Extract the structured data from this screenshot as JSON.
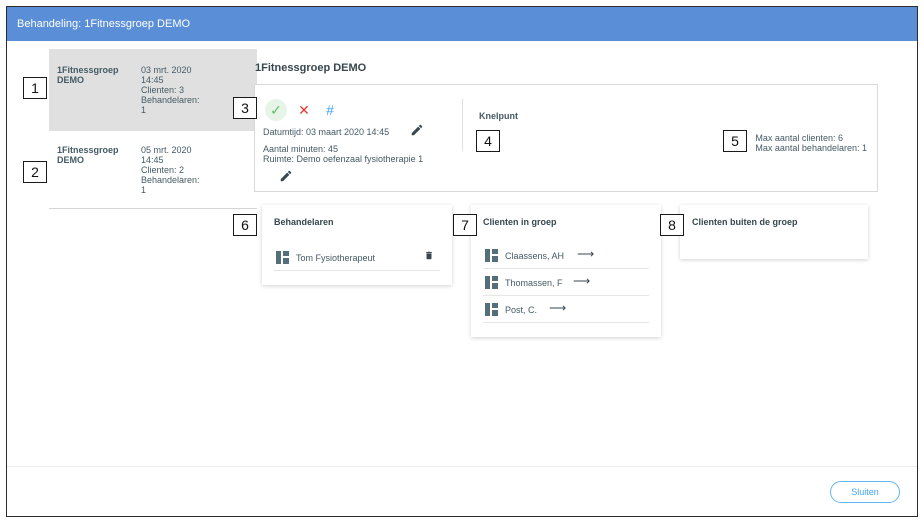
{
  "window": {
    "title": "Behandeling: 1Fitnessgroep DEMO"
  },
  "sessions": [
    {
      "name": "1Fitnessgroep DEMO",
      "date": "03 mrt. 2020",
      "time": "14:45",
      "clients": "Clienten: 3",
      "therapists": "Behandelaren:",
      "therapists_count": "1",
      "selected": true
    },
    {
      "name": "1Fitnessgroep DEMO",
      "date": "05 mrt. 2020",
      "time": "14:45",
      "clients": "Clienten: 2",
      "therapists": "Behandelaren:",
      "therapists_count": "1",
      "selected": false
    }
  ],
  "markers": [
    "1",
    "2",
    "3",
    "4",
    "5",
    "6",
    "7",
    "8"
  ],
  "detail": {
    "heading": "1Fitnessgroep DEMO",
    "icons": {
      "approve": "check-icon",
      "reject": "close-icon",
      "number": "hash-icon"
    },
    "datetime": "Datumtijd: 03 maart 2020 14:45",
    "minutes": "Aantal minuten: 45",
    "room": "Ruimte: Demo oefenzaal fysiotherapie 1",
    "knelpunt": "Knelpunt",
    "max_clients": "Max aantal clienten: 6",
    "max_therapists": "Max aantal behandelaren: 1"
  },
  "therapists_card": {
    "title": "Behandelaren",
    "items": [
      {
        "name": "Tom Fysiotherapeut"
      }
    ]
  },
  "clients_card": {
    "title": "Clienten in groep",
    "items": [
      {
        "name": "Claassens, AH"
      },
      {
        "name": "Thomassen, F"
      },
      {
        "name": "Post, C."
      }
    ]
  },
  "outside_card": {
    "title": "Clienten buiten de groep",
    "items": []
  },
  "footer": {
    "close_label": "Sluiten"
  },
  "colors": {
    "titlebar": "#5a8fd8",
    "accent": "#42a5f5",
    "approve": "#66bb6a",
    "reject": "#e53935"
  }
}
